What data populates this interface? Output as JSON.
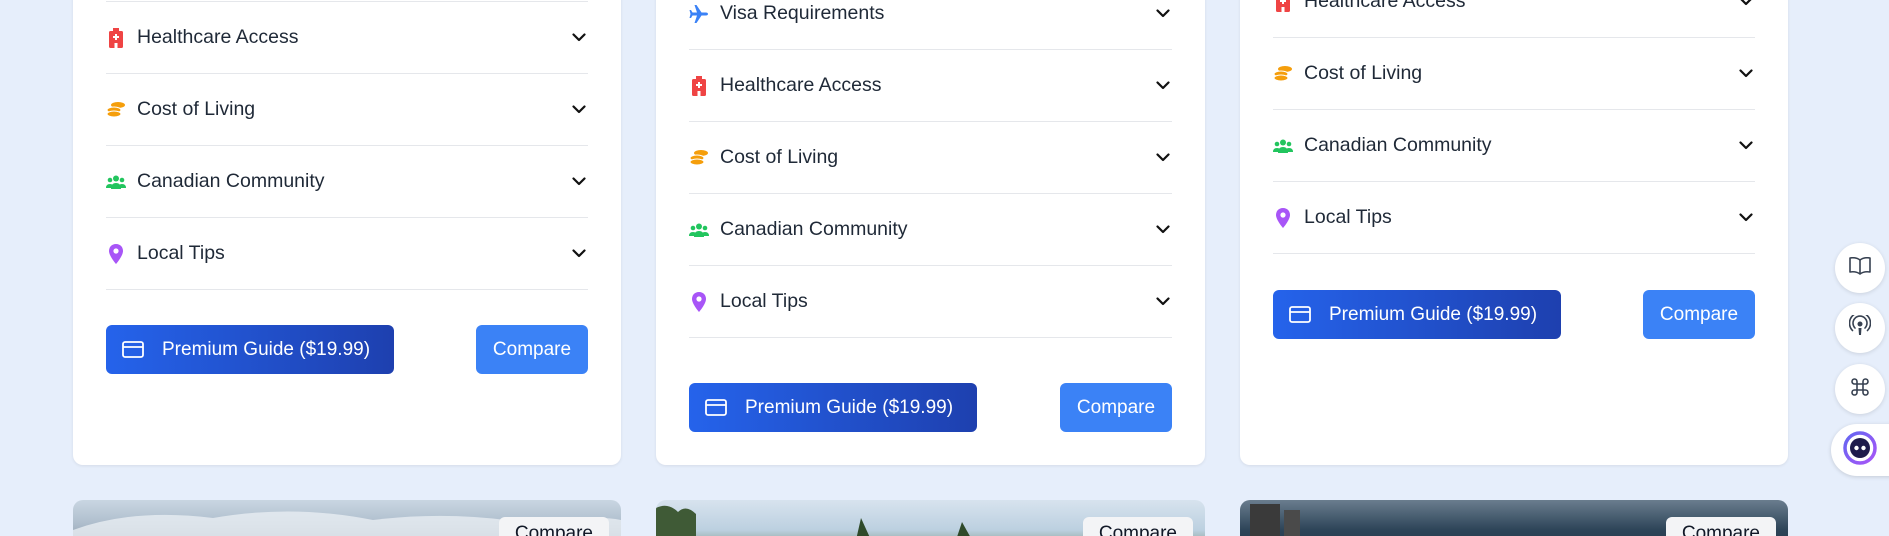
{
  "cards": [
    {
      "items": [
        {
          "label": "Healthcare Access",
          "icon": "hospital-icon"
        },
        {
          "label": "Cost of Living",
          "icon": "coins-icon"
        },
        {
          "label": "Canadian Community",
          "icon": "users-icon"
        },
        {
          "label": "Local Tips",
          "icon": "map-pin-icon"
        }
      ],
      "premium_label": "Premium Guide ($19.99)",
      "compare_label": "Compare"
    },
    {
      "items": [
        {
          "label": "Visa Requirements",
          "icon": "plane-icon"
        },
        {
          "label": "Healthcare Access",
          "icon": "hospital-icon"
        },
        {
          "label": "Cost of Living",
          "icon": "coins-icon"
        },
        {
          "label": "Canadian Community",
          "icon": "users-icon"
        },
        {
          "label": "Local Tips",
          "icon": "map-pin-icon"
        }
      ],
      "premium_label": "Premium Guide ($19.99)",
      "compare_label": "Compare"
    },
    {
      "items": [
        {
          "label": "Healthcare Access",
          "icon": "hospital-icon"
        },
        {
          "label": "Cost of Living",
          "icon": "coins-icon"
        },
        {
          "label": "Canadian Community",
          "icon": "users-icon"
        },
        {
          "label": "Local Tips",
          "icon": "map-pin-icon"
        }
      ],
      "premium_label": "Premium Guide ($19.99)",
      "compare_label": "Compare"
    }
  ],
  "photo_cards": [
    {
      "compare_label": "Compare"
    },
    {
      "compare_label": "Compare"
    },
    {
      "compare_label": "Compare"
    }
  ],
  "colors": {
    "hospital": "#ef4444",
    "coins": "#f59e0b",
    "users": "#22c55e",
    "pin": "#a855f7",
    "plane": "#3b82f6",
    "compare_bg": "#3b82f6",
    "premium_start": "#2563eb",
    "premium_end": "#1e40af"
  },
  "side_tools": [
    {
      "icon": "book-icon"
    },
    {
      "icon": "podcast-icon"
    },
    {
      "icon": "command-icon"
    },
    {
      "icon": "assistant-icon"
    }
  ]
}
